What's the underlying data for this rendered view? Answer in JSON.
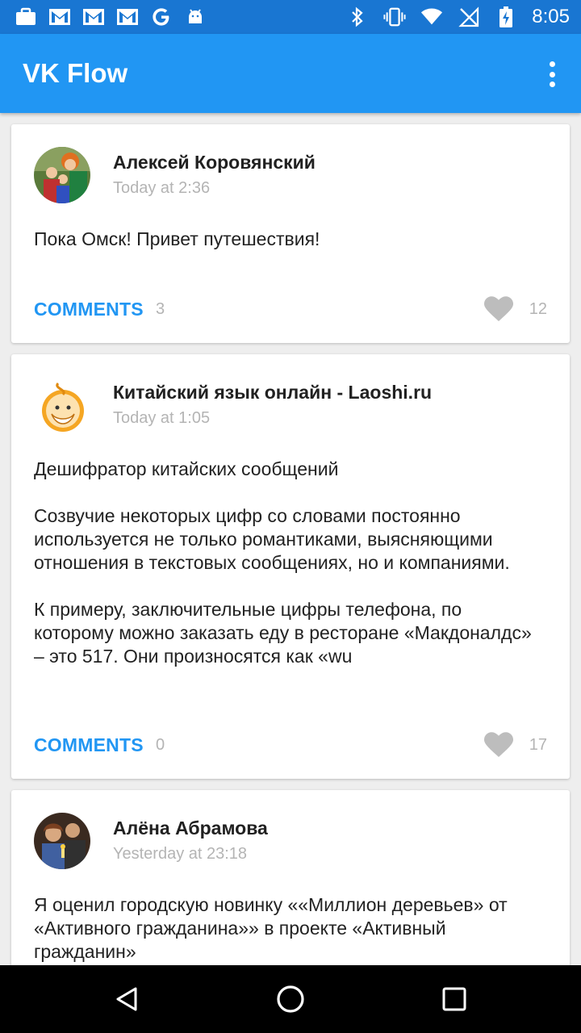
{
  "status_bar": {
    "time": "8:05",
    "left_icons": [
      "briefcase-icon",
      "gmail-icon",
      "gmail-icon",
      "gmail-icon",
      "google-icon",
      "android-icon"
    ],
    "right_icons": [
      "bluetooth-icon",
      "vibrate-icon",
      "wifi-icon",
      "no-signal-icon",
      "battery-charging-icon"
    ]
  },
  "app_bar": {
    "title": "VK Flow",
    "menu_icon": "overflow-menu-icon"
  },
  "colors": {
    "primary": "#2196f3",
    "primary_dark": "#1976d2",
    "accent_text": "#2196f3",
    "muted_text": "#b4b4b4"
  },
  "posts": [
    {
      "author": "Алексей Коровянский",
      "time": "Today at 2:36",
      "text": "Пока Омск! Привет путешествия!",
      "comments_label": "COMMENTS",
      "comments_count": "3",
      "likes_count": "12"
    },
    {
      "author": "Китайский язык онлайн - Laoshi.ru",
      "time": "Today at 1:05",
      "text": "Дешифратор китайских сообщений\n\nСозвучие некоторых цифр со словами постоянно используется не только романтиками, выясняющими отношения в текстовых сообщениях, но и компаниями.\n\nК примеру, заключительные цифры телефона, по которому можно заказать еду в ресторане «Макдоналдс» – это 517. Они произносятся как «wu",
      "comments_label": "COMMENTS",
      "comments_count": "0",
      "likes_count": "17"
    },
    {
      "author": "Алёна Абрамова",
      "time": "Yesterday at 23:18",
      "text": "Я оценил городскую новинку ««Миллион деревьев» от «Активного гражданина»» в проекте «Активный гражданин»"
    }
  ],
  "nav_bar": {
    "buttons": [
      "back-icon",
      "home-icon",
      "recents-icon"
    ]
  }
}
